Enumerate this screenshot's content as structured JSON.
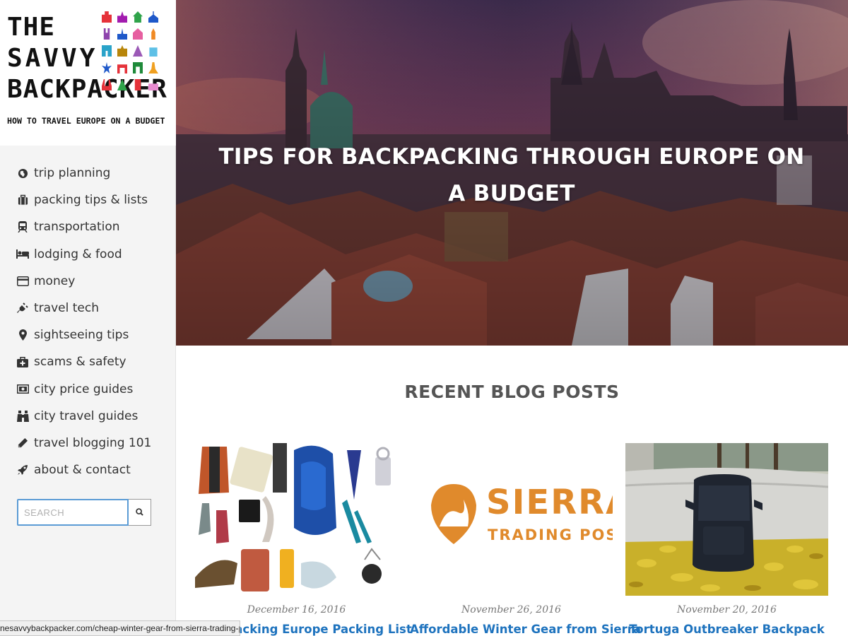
{
  "logo": {
    "line1": "THE",
    "line2": "SAVVY",
    "line3": "BACKPACKER",
    "tagline": "HOW TO TRAVEL EUROPE ON A BUDGET"
  },
  "nav": {
    "items": [
      {
        "label": "trip planning",
        "icon": "globe-icon"
      },
      {
        "label": "packing tips & lists",
        "icon": "suitcase-icon"
      },
      {
        "label": "transportation",
        "icon": "train-icon"
      },
      {
        "label": "lodging & food",
        "icon": "bed-icon"
      },
      {
        "label": "money",
        "icon": "credit-card-icon"
      },
      {
        "label": "travel tech",
        "icon": "plug-icon"
      },
      {
        "label": "sightseeing tips",
        "icon": "map-marker-icon"
      },
      {
        "label": "scams & safety",
        "icon": "medkit-icon"
      },
      {
        "label": "city price guides",
        "icon": "money-bill-icon"
      },
      {
        "label": "city travel guides",
        "icon": "binoculars-icon"
      },
      {
        "label": "travel blogging 101",
        "icon": "pencil-icon"
      },
      {
        "label": "about & contact",
        "icon": "rocket-icon"
      }
    ]
  },
  "search": {
    "placeholder": "SEARCH",
    "icon": "search-icon"
  },
  "hero": {
    "title": "TIPS FOR BACKPACKING THROUGH EUROPE ON A BUDGET"
  },
  "main": {
    "section_title": "RECENT BLOG POSTS",
    "posts": [
      {
        "date": "December 16, 2016",
        "title": "Backpacking Europe Packing List"
      },
      {
        "date": "November 26, 2016",
        "title": "Affordable Winter Gear from Sierra"
      },
      {
        "date": "November 20, 2016",
        "title": "Tortuga Outbreaker Backpack"
      }
    ],
    "sierra_logo": {
      "word1": "SIERRA",
      "word2": "TRADING POST"
    }
  },
  "statusbar": {
    "url": "nesavvybackpacker.com/cheap-winter-gear-from-sierra-trading-post/"
  },
  "colors": {
    "link": "#1e73be",
    "sidebar_bg": "#f4f4f4",
    "sierra_orange": "#e08a2c"
  }
}
